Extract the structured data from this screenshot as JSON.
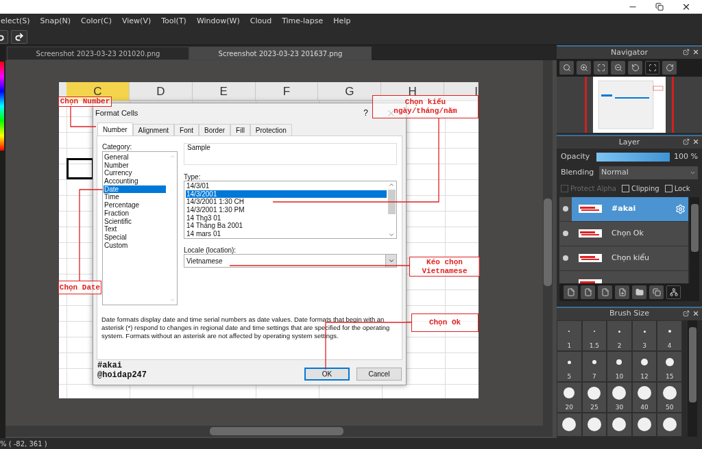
{
  "menu": [
    "elect(S)",
    "Snap(N)",
    "Color(C)",
    "View(V)",
    "Tool(T)",
    "Window(W)",
    "Cloud",
    "Time-lapse",
    "Help"
  ],
  "document_tabs": [
    {
      "label": "Screenshot 2023-03-23 201020.png",
      "selected": false
    },
    {
      "label": "Screenshot 2023-03-23 201637.png",
      "selected": true
    }
  ],
  "canvas": {
    "sheet_columns": [
      {
        "label": "C",
        "selected": true
      },
      {
        "label": "D",
        "selected": false
      },
      {
        "label": "E",
        "selected": false
      },
      {
        "label": "F",
        "selected": false
      },
      {
        "label": "G",
        "selected": false
      },
      {
        "label": "H",
        "selected": false
      },
      {
        "label": "I",
        "selected": false
      }
    ],
    "dialog": {
      "title": "Format Cells",
      "help": "?",
      "tabs": [
        {
          "label": "Number",
          "selected": true
        },
        {
          "label": "Alignment",
          "selected": false
        },
        {
          "label": "Font",
          "selected": false
        },
        {
          "label": "Border",
          "selected": false
        },
        {
          "label": "Fill",
          "selected": false
        },
        {
          "label": "Protection",
          "selected": false
        }
      ],
      "category_label": "Category:",
      "categories": [
        {
          "label": "General",
          "selected": false
        },
        {
          "label": "Number",
          "selected": false
        },
        {
          "label": "Currency",
          "selected": false
        },
        {
          "label": "Accounting",
          "selected": false
        },
        {
          "label": "Date",
          "selected": true
        },
        {
          "label": "Time",
          "selected": false
        },
        {
          "label": "Percentage",
          "selected": false
        },
        {
          "label": "Fraction",
          "selected": false
        },
        {
          "label": "Scientific",
          "selected": false
        },
        {
          "label": "Text",
          "selected": false
        },
        {
          "label": "Special",
          "selected": false
        },
        {
          "label": "Custom",
          "selected": false
        }
      ],
      "sample_label": "Sample",
      "type_label": "Type:",
      "types": [
        {
          "label": "14/3/01",
          "selected": false
        },
        {
          "label": "14/3/2001",
          "selected": true
        },
        {
          "label": "14/3/2001 1:30 CH",
          "selected": false
        },
        {
          "label": "14/3/2001 1:30 PM",
          "selected": false
        },
        {
          "label": "14 Thg3 01",
          "selected": false
        },
        {
          "label": "14 Tháng Ba 2001",
          "selected": false
        },
        {
          "label": "14 mars 01",
          "selected": false
        }
      ],
      "locale_label": "Locale (location):",
      "locale_value": "Vietnamese",
      "description": "Date formats display date and time serial numbers as date values.  Date formats that begin with an asterisk (*) respond to changes in regional date and time settings that are specified for the operating system. Formats without an asterisk are not affected by operating system settings.",
      "buttons": [
        {
          "label": "OK",
          "default": true
        },
        {
          "label": "Cancel",
          "default": false
        }
      ]
    },
    "annotations": [
      {
        "text": "Chọn Number"
      },
      {
        "text": "Chọn kiểu\nngày/tháng/năm"
      },
      {
        "text": "Chọn Date"
      },
      {
        "text": "Kéo chọn\nVietnamese"
      },
      {
        "text": "Chọn Ok"
      }
    ],
    "signature": [
      "#akai",
      "@hoidap247"
    ]
  },
  "status_bar": "% ( -82, 361 )",
  "navigator": {
    "title": "Navigator"
  },
  "layer_panel": {
    "title": "Layer",
    "opacity_label": "Opacity",
    "opacity": {
      "level": 1
    },
    "opacity_reading": "100 %",
    "blending_label": "Blending",
    "blending_value": "Normal",
    "options": [
      {
        "label": "Protect Alpha",
        "checked": false,
        "disabled": true
      },
      {
        "label": "Clipping",
        "checked": false,
        "disabled": false
      },
      {
        "label": "Lock",
        "checked": false,
        "disabled": false
      }
    ],
    "layers": [
      {
        "name": "#akai",
        "selected": true
      },
      {
        "name": "Chọn Ok",
        "selected": false
      },
      {
        "name": "Chọn kiểu",
        "selected": false
      }
    ]
  },
  "brush_size": {
    "title": "Brush Size",
    "sizes": [
      "1",
      "1.5",
      "2",
      "3",
      "4",
      "5",
      "7",
      "10",
      "12",
      "15",
      "20",
      "25",
      "30",
      "40",
      "50"
    ]
  }
}
